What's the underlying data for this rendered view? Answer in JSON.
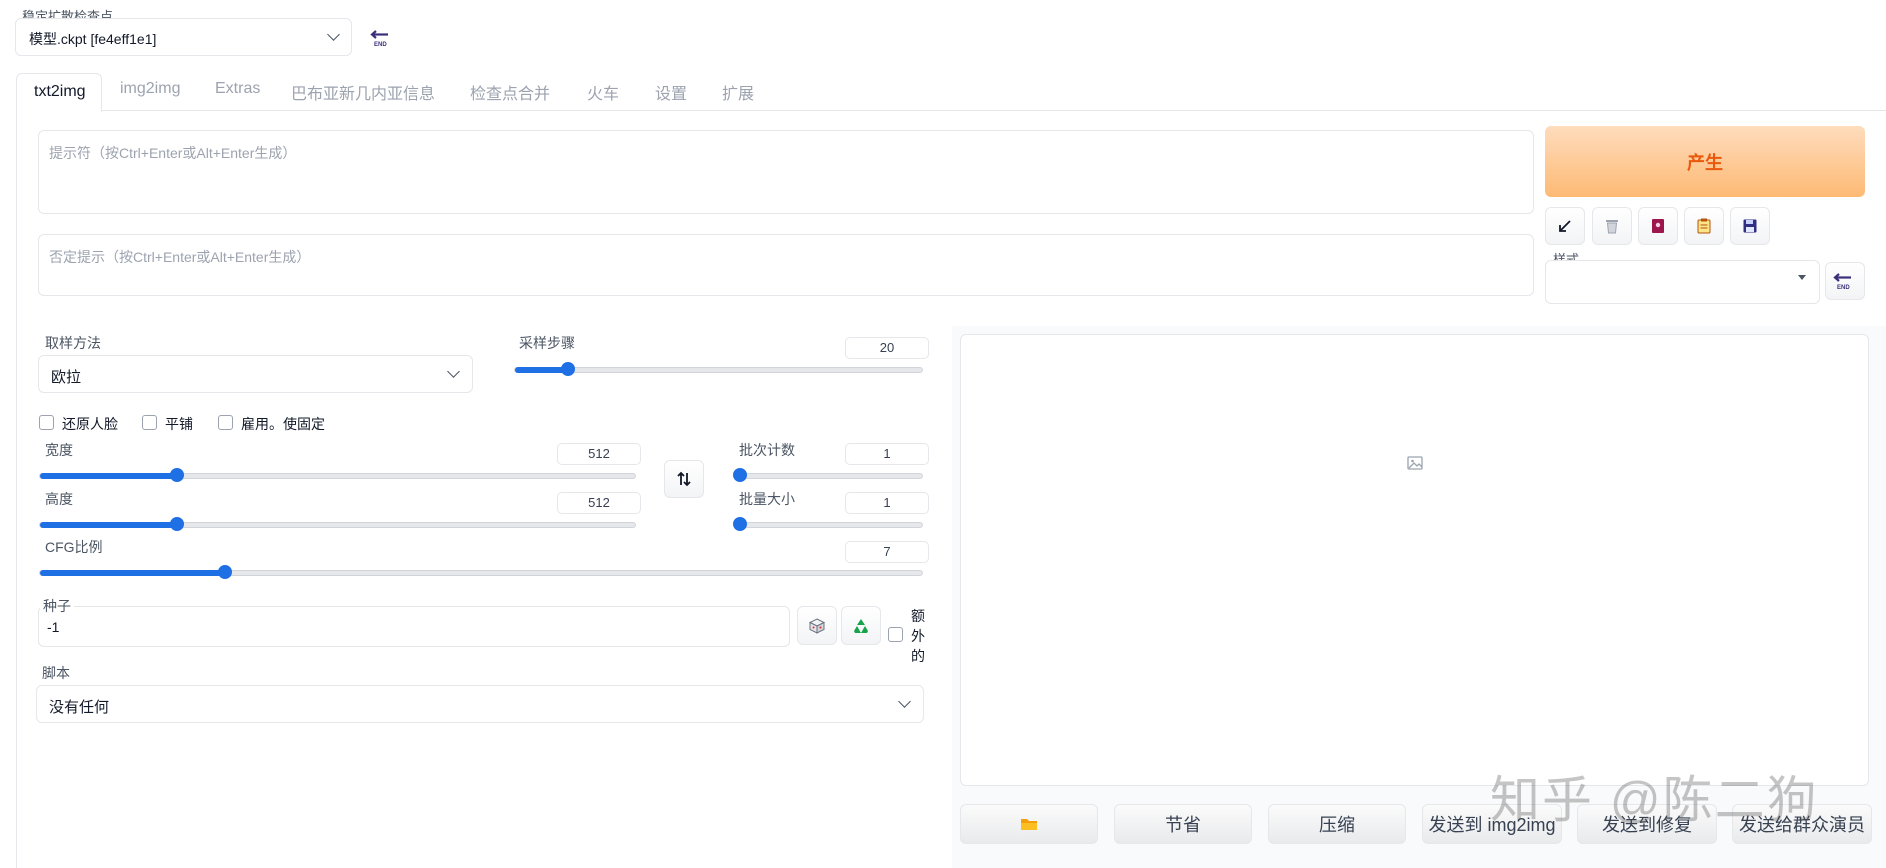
{
  "checkpoint": {
    "label": "稳定扩散检查点",
    "value": "模型.ckpt [fe4eff1e1]"
  },
  "tabs": [
    {
      "label": "txt2img",
      "active": true
    },
    {
      "label": "img2img"
    },
    {
      "label": "Extras"
    },
    {
      "label": "巴布亚新几内亚信息"
    },
    {
      "label": "检查点合并"
    },
    {
      "label": "火车"
    },
    {
      "label": "设置"
    },
    {
      "label": "扩展"
    }
  ],
  "prompt": {
    "placeholder": "提示符（按Ctrl+Enter或Alt+Enter生成）"
  },
  "negative_prompt": {
    "placeholder": "否定提示（按Ctrl+Enter或Alt+Enter生成）"
  },
  "generate": {
    "label": "产生"
  },
  "styles": {
    "label": "样式",
    "value": ""
  },
  "sampling_method": {
    "label": "取样方法",
    "value": "欧拉"
  },
  "sampling_steps": {
    "label": "采样步骤",
    "value": "20",
    "fraction": 0.13
  },
  "options": {
    "restore_faces": "还原人脸",
    "tiling": "平铺",
    "hires_fix": "雇用。使固定"
  },
  "width": {
    "label": "宽度",
    "value": "512",
    "fraction": 0.23
  },
  "height": {
    "label": "高度",
    "value": "512",
    "fraction": 0.23
  },
  "batch_count": {
    "label": "批次计数",
    "value": "1",
    "fraction": 0.0
  },
  "batch_size": {
    "label": "批量大小",
    "value": "1",
    "fraction": 0.0
  },
  "cfg_scale": {
    "label": "CFG比例",
    "value": "7",
    "fraction": 0.21
  },
  "seed": {
    "label": "种子",
    "value": "-1",
    "extra": [
      "额",
      "外",
      "的"
    ]
  },
  "script": {
    "label": "脚本",
    "value": "没有任何"
  },
  "bottom_buttons": {
    "save": "节省",
    "zip": "压缩",
    "send_img2img": "发送到 img2img",
    "send_inpaint": "发送到修复",
    "send_extras": "发送给群众演员"
  },
  "watermark": "知乎 @陈二狗",
  "colors": {
    "accent": "#1f6fe5",
    "generate_text": "#ea580c",
    "generate_bg": "#fdba74"
  },
  "icons": [
    "end-arrow-icon",
    "dropdown-chevron-icon",
    "arrow-icon",
    "trash-icon",
    "book-icon",
    "clipboard-icon",
    "save-icon",
    "swap-icon",
    "dice-icon",
    "recycle-icon",
    "image-icon",
    "folder-icon"
  ]
}
